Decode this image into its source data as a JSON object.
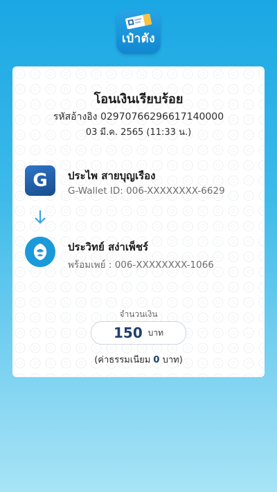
{
  "app": {
    "logo_text": "เป๋าตัง"
  },
  "receipt": {
    "title": "โอนเงินเรียบร้อย",
    "reference": "รหัสอ้างอิง 02970766296617140000",
    "datetime": "03 มี.ค. 2565 (11:33 น.)"
  },
  "sender": {
    "icon": "g-wallet-logo-icon",
    "name": "ประไพ สายบุญเรือง",
    "account": "G-Wallet ID: 006-XXXXXXXX-6629"
  },
  "receiver": {
    "icon": "kasikorn-bank-logo-icon",
    "name": "ประวิทย์ สง่าเพ็ชร์",
    "account": "พร้อมเพย์ : 006-XXXXXXXX-1066"
  },
  "amount": {
    "label": "จำนวนเงิน",
    "value": "150",
    "unit": "บาท"
  },
  "fee": {
    "prefix": "(ค่าธรรมเนียม ",
    "value": "0",
    "suffix": " บาท)"
  },
  "colors": {
    "background_top": "#1aa7e3",
    "background_bottom": "#a7e4f6",
    "amount_text": "#1d3f6e",
    "arrow": "#2ea3df"
  }
}
